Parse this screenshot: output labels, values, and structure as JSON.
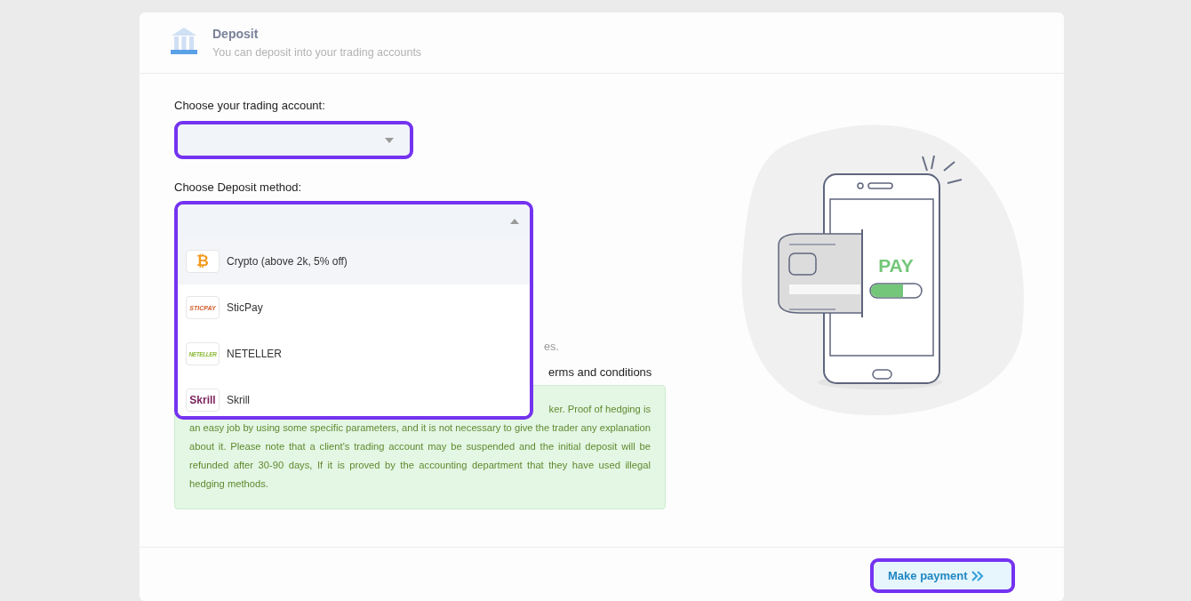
{
  "header": {
    "title": "Deposit",
    "subtitle": "You can deposit into your trading accounts"
  },
  "account_field": {
    "label": "Choose your trading account:",
    "expanded": false
  },
  "method_field": {
    "label": "Choose Deposit method:",
    "expanded": true,
    "options": [
      {
        "kind": "crypto",
        "logo": "₿",
        "label": "Crypto (above 2k, 5% off)",
        "selected": true
      },
      {
        "kind": "sticpay",
        "logo": "STICPAY",
        "label": "SticPay",
        "selected": false
      },
      {
        "kind": "neteller",
        "logo": "NETELLER",
        "label": "NETELLER",
        "selected": false
      },
      {
        "kind": "skrill",
        "logo": "Skrill",
        "label": "Skrill",
        "selected": false
      }
    ]
  },
  "covered_lines": [
    "es.",
    "erms and conditions"
  ],
  "notice": {
    "first_line": "ker. Proof of hedging is",
    "text": "an easy job by using some specific parameters, and it is not necessary to give the trader any explanation about it. Please note that a client's trading account may be suspended and the initial deposit will be refunded after 30-90 days, If it is proved by the accounting department that they have used illegal hedging methods."
  },
  "illustration": {
    "label": "PAY"
  },
  "button": {
    "label": "Make payment"
  }
}
